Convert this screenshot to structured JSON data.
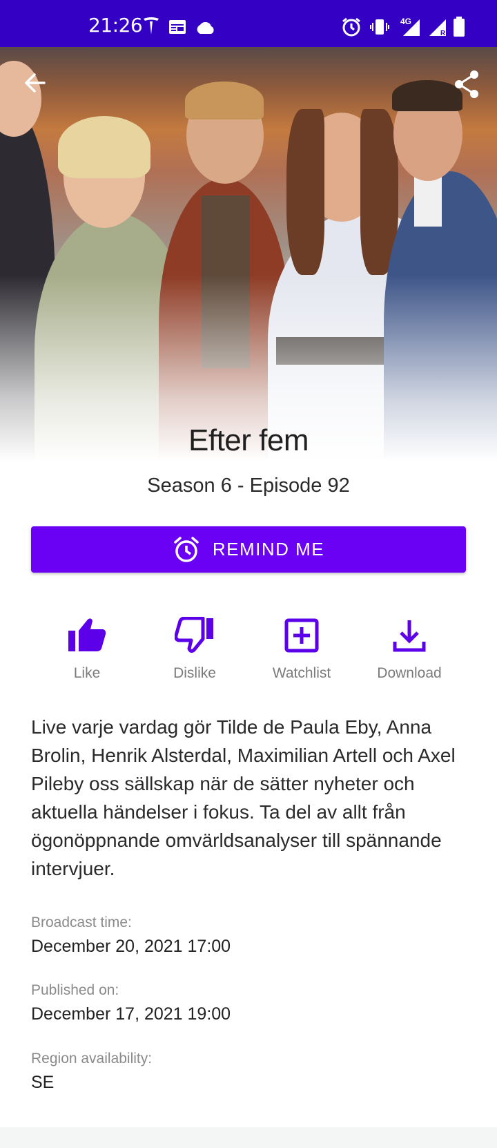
{
  "status_bar": {
    "time": "21:26",
    "network": "4G"
  },
  "program": {
    "title": "Efter fem",
    "episode": "Season 6 - Episode 92"
  },
  "remind_button": {
    "label": "REMIND ME"
  },
  "actions": [
    {
      "label": "Like",
      "icon": "thumb-up-icon"
    },
    {
      "label": "Dislike",
      "icon": "thumb-down-icon"
    },
    {
      "label": "Watchlist",
      "icon": "add-box-icon"
    },
    {
      "label": "Download",
      "icon": "download-icon"
    }
  ],
  "description": "Live varje vardag gör Tilde de Paula Eby, Anna Brolin, Henrik Alsterdal, Maximilian Artell och Axel Pileby oss sällskap när de sätter nyheter och aktuella händelser i fokus. Ta del av allt från ögonöppnande omvärldsanalyser till spännande intervjuer.",
  "details": {
    "broadcast_label": "Broadcast time:",
    "broadcast_value": "December 20, 2021 17:00",
    "published_label": "Published on:",
    "published_value": "December 17, 2021 19:00",
    "region_label": "Region availability:",
    "region_value": "SE"
  },
  "colors": {
    "statusbar": "#3300c4",
    "accent": "#6a00f4",
    "icon": "#5b00e8"
  }
}
